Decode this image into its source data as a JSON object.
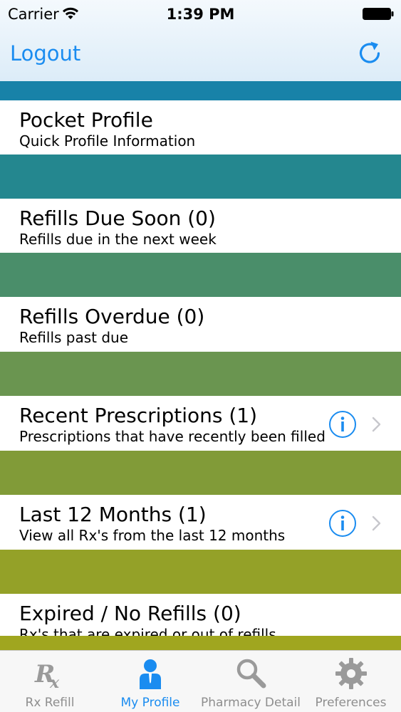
{
  "status_bar": {
    "carrier": "Carrier",
    "time": "1:39 PM"
  },
  "nav": {
    "logout_label": "Logout",
    "refresh_icon": "refresh-icon"
  },
  "colors": {
    "accent": "#1a8cf0",
    "bands": [
      "#1882a8",
      "#24878f",
      "#4a8e6a",
      "#6a9550",
      "#819b38",
      "#94a128",
      "#a0a61f"
    ]
  },
  "rows": [
    {
      "title": "Pocket Profile",
      "subtitle": "Quick Profile Information"
    },
    {
      "title": "Refills Due Soon (0)",
      "subtitle": "Refills due in the next week"
    },
    {
      "title": "Refills Overdue (0)",
      "subtitle": "Refills past due"
    },
    {
      "title": "Recent Prescriptions (1)",
      "subtitle": "Prescriptions that have recently been filled"
    },
    {
      "title": "Last 12 Months (1)",
      "subtitle": "View all Rx's from the last 12 months"
    },
    {
      "title": "Expired / No Refills (0)",
      "subtitle": "Rx's that are expired or out of refills"
    }
  ],
  "tabs": [
    {
      "label": "Rx Refill",
      "icon": "rx-icon"
    },
    {
      "label": "My Profile",
      "icon": "person-icon"
    },
    {
      "label": "Pharmacy Detail",
      "icon": "search-icon"
    },
    {
      "label": "Preferences",
      "icon": "gear-icon"
    }
  ]
}
